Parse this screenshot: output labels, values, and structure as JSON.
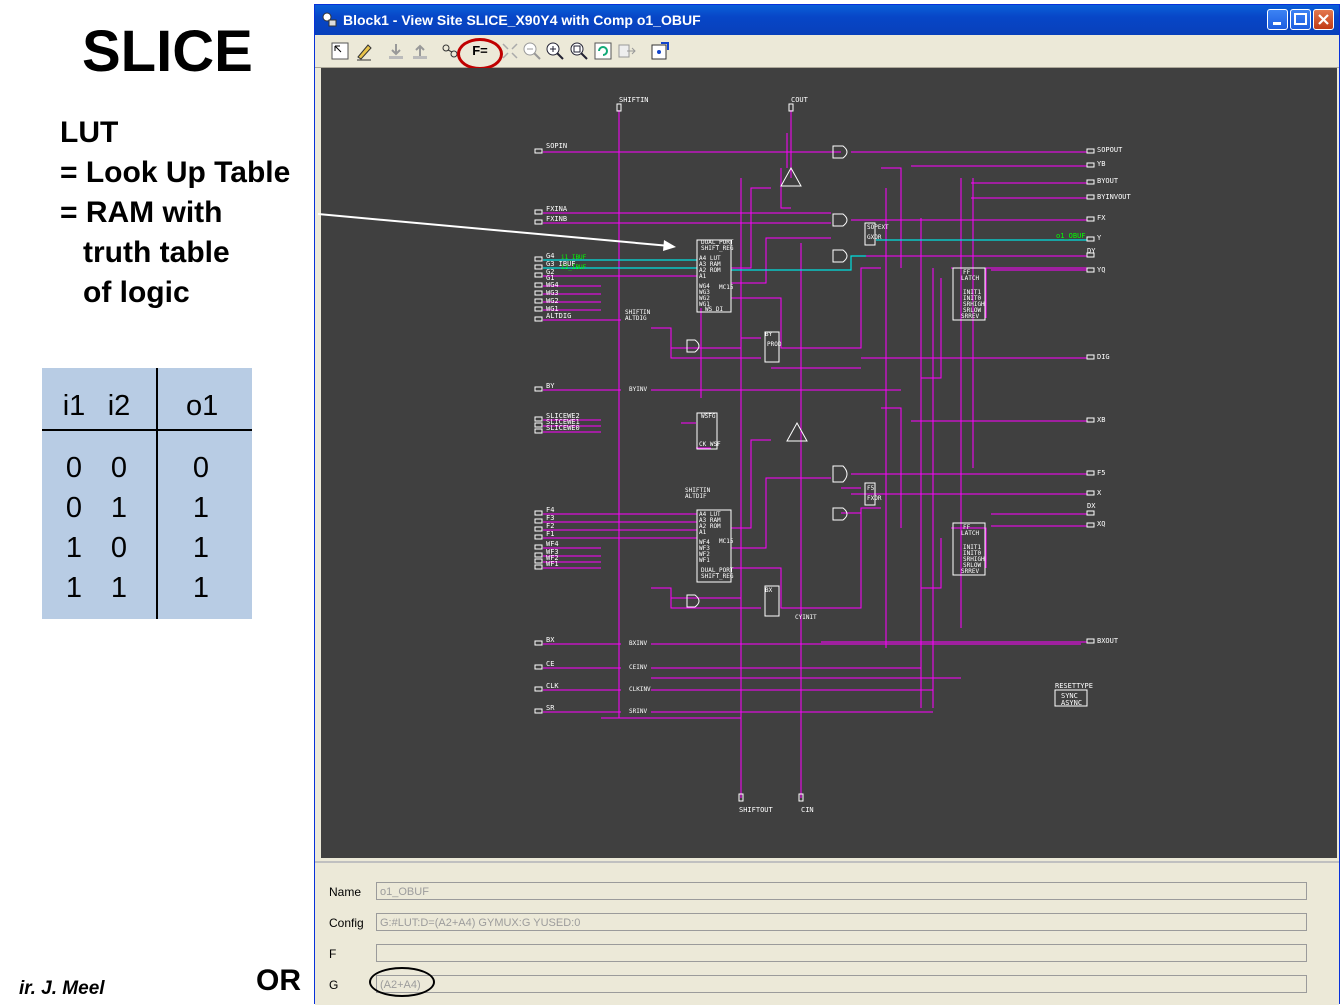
{
  "slide": {
    "title": "SLICE",
    "lut_lines": [
      "LUT",
      "= Look Up Table",
      "= RAM with",
      "truth table",
      "of logic"
    ],
    "truth_table": {
      "headers": [
        "i1",
        "i2",
        "o1"
      ],
      "rows": [
        [
          "0",
          "0",
          "0"
        ],
        [
          "0",
          "1",
          "1"
        ],
        [
          "1",
          "0",
          "1"
        ],
        [
          "1",
          "1",
          "1"
        ]
      ]
    },
    "author": "ir. J. Meel",
    "or_label": "OR"
  },
  "window": {
    "title": "Block1 - View Site SLICE_X90Y4 with Comp o1_OBUF",
    "toolbar_icons": [
      "select-icon",
      "edit-icon",
      "push-icon",
      "pop-icon",
      "route-icon",
      "equation-icon",
      "fit-icon",
      "zoom-out-icon",
      "zoom-in-icon",
      "zoom-area-icon",
      "refresh-icon",
      "export-icon",
      "config-icon"
    ],
    "equation_button": "F="
  },
  "schematic": {
    "pins_left": [
      "SOPIN",
      "FXINA",
      "FXINB",
      "G4 ",
      "G3 IBUF",
      "G2",
      "G1",
      "WG4",
      "WG3",
      "WG2",
      "WG1",
      "ALTDIG",
      "BY",
      "SLICEWE2",
      "SLICEWE1",
      "SLICEWE0",
      "F4",
      "F3",
      "F2",
      "F1",
      "WF4",
      "WF3",
      "WF2",
      "WF1",
      "BX",
      "CE",
      "CLK",
      "SR"
    ],
    "pins_right": [
      "SOPOUT",
      "YB",
      "BYOUT",
      "BYINVOUT",
      "FX",
      "Y",
      "DY",
      "YQ",
      "DIG",
      "XB",
      "F5",
      "X",
      "DX",
      "XQ",
      "BXOUT"
    ],
    "pins_top": [
      "SHIFTIN",
      "COUT"
    ],
    "pins_bottom": [
      "SHIFTOUT",
      "CIN"
    ],
    "net_label_out": "o1_OBUF",
    "net_label_in": "i1_IBUF",
    "net_label_in2": "i2_IBUF",
    "reset_type": "RESETTYPE",
    "reset_opts": [
      "SYNC",
      "ASYNC"
    ],
    "block_labels": {
      "lut_g": [
        "DUAL_PORT",
        "SHIFT_REG",
        "A4 LUT",
        "A3 RAM",
        "A2 ROM",
        "A1",
        "WG4",
        "WG3",
        "WG2",
        "WG1",
        "WS DI",
        "MC15"
      ],
      "lut_f": [
        "A4 LUT",
        "A3 RAM",
        "A2 ROM",
        "A1",
        "WF4",
        "WF3",
        "WF2",
        "WF1",
        "DUAL_PORT",
        "SHIFT_REG",
        "MC15"
      ],
      "ff_y": [
        "FF",
        "LATCH",
        "INIT1",
        "INIT0",
        "SRHIGH",
        "SRLOW",
        "SRREV"
      ],
      "ff_x": [
        "FF",
        "LATCH",
        "INIT1",
        "INIT0",
        "SRHIGH",
        "SRLOW",
        "SRREV"
      ],
      "misc": [
        "SHIFTIN",
        "ALTDIG",
        "WSFG",
        "CK WSF",
        "SOPEXT",
        "GXOR",
        "FXOR",
        "F5",
        "PROD",
        "BY",
        "BX",
        "SHIFTIN",
        "ALTDIF",
        "CYINIT",
        "BXINV",
        "BYINV",
        "CEINV",
        "CLKINV",
        "SRINV"
      ]
    }
  },
  "properties": {
    "name_label": "Name",
    "name_value": "o1_OBUF",
    "config_label": "Config",
    "config_value": "G:#LUT:D=(A2+A4) GYMUX:G YUSED:0",
    "f_label": "F",
    "f_value": "",
    "g_label": "G",
    "g_value": "(A2+A4)"
  },
  "colors": {
    "wire": "#ff00ff",
    "net_highlight": "#00e0e0",
    "net_label": "#00ff00",
    "canvas_bg": "#404040",
    "cell_outline": "#ffffff",
    "annotation_red": "#c00000",
    "table_bg": "#b8cce4"
  }
}
